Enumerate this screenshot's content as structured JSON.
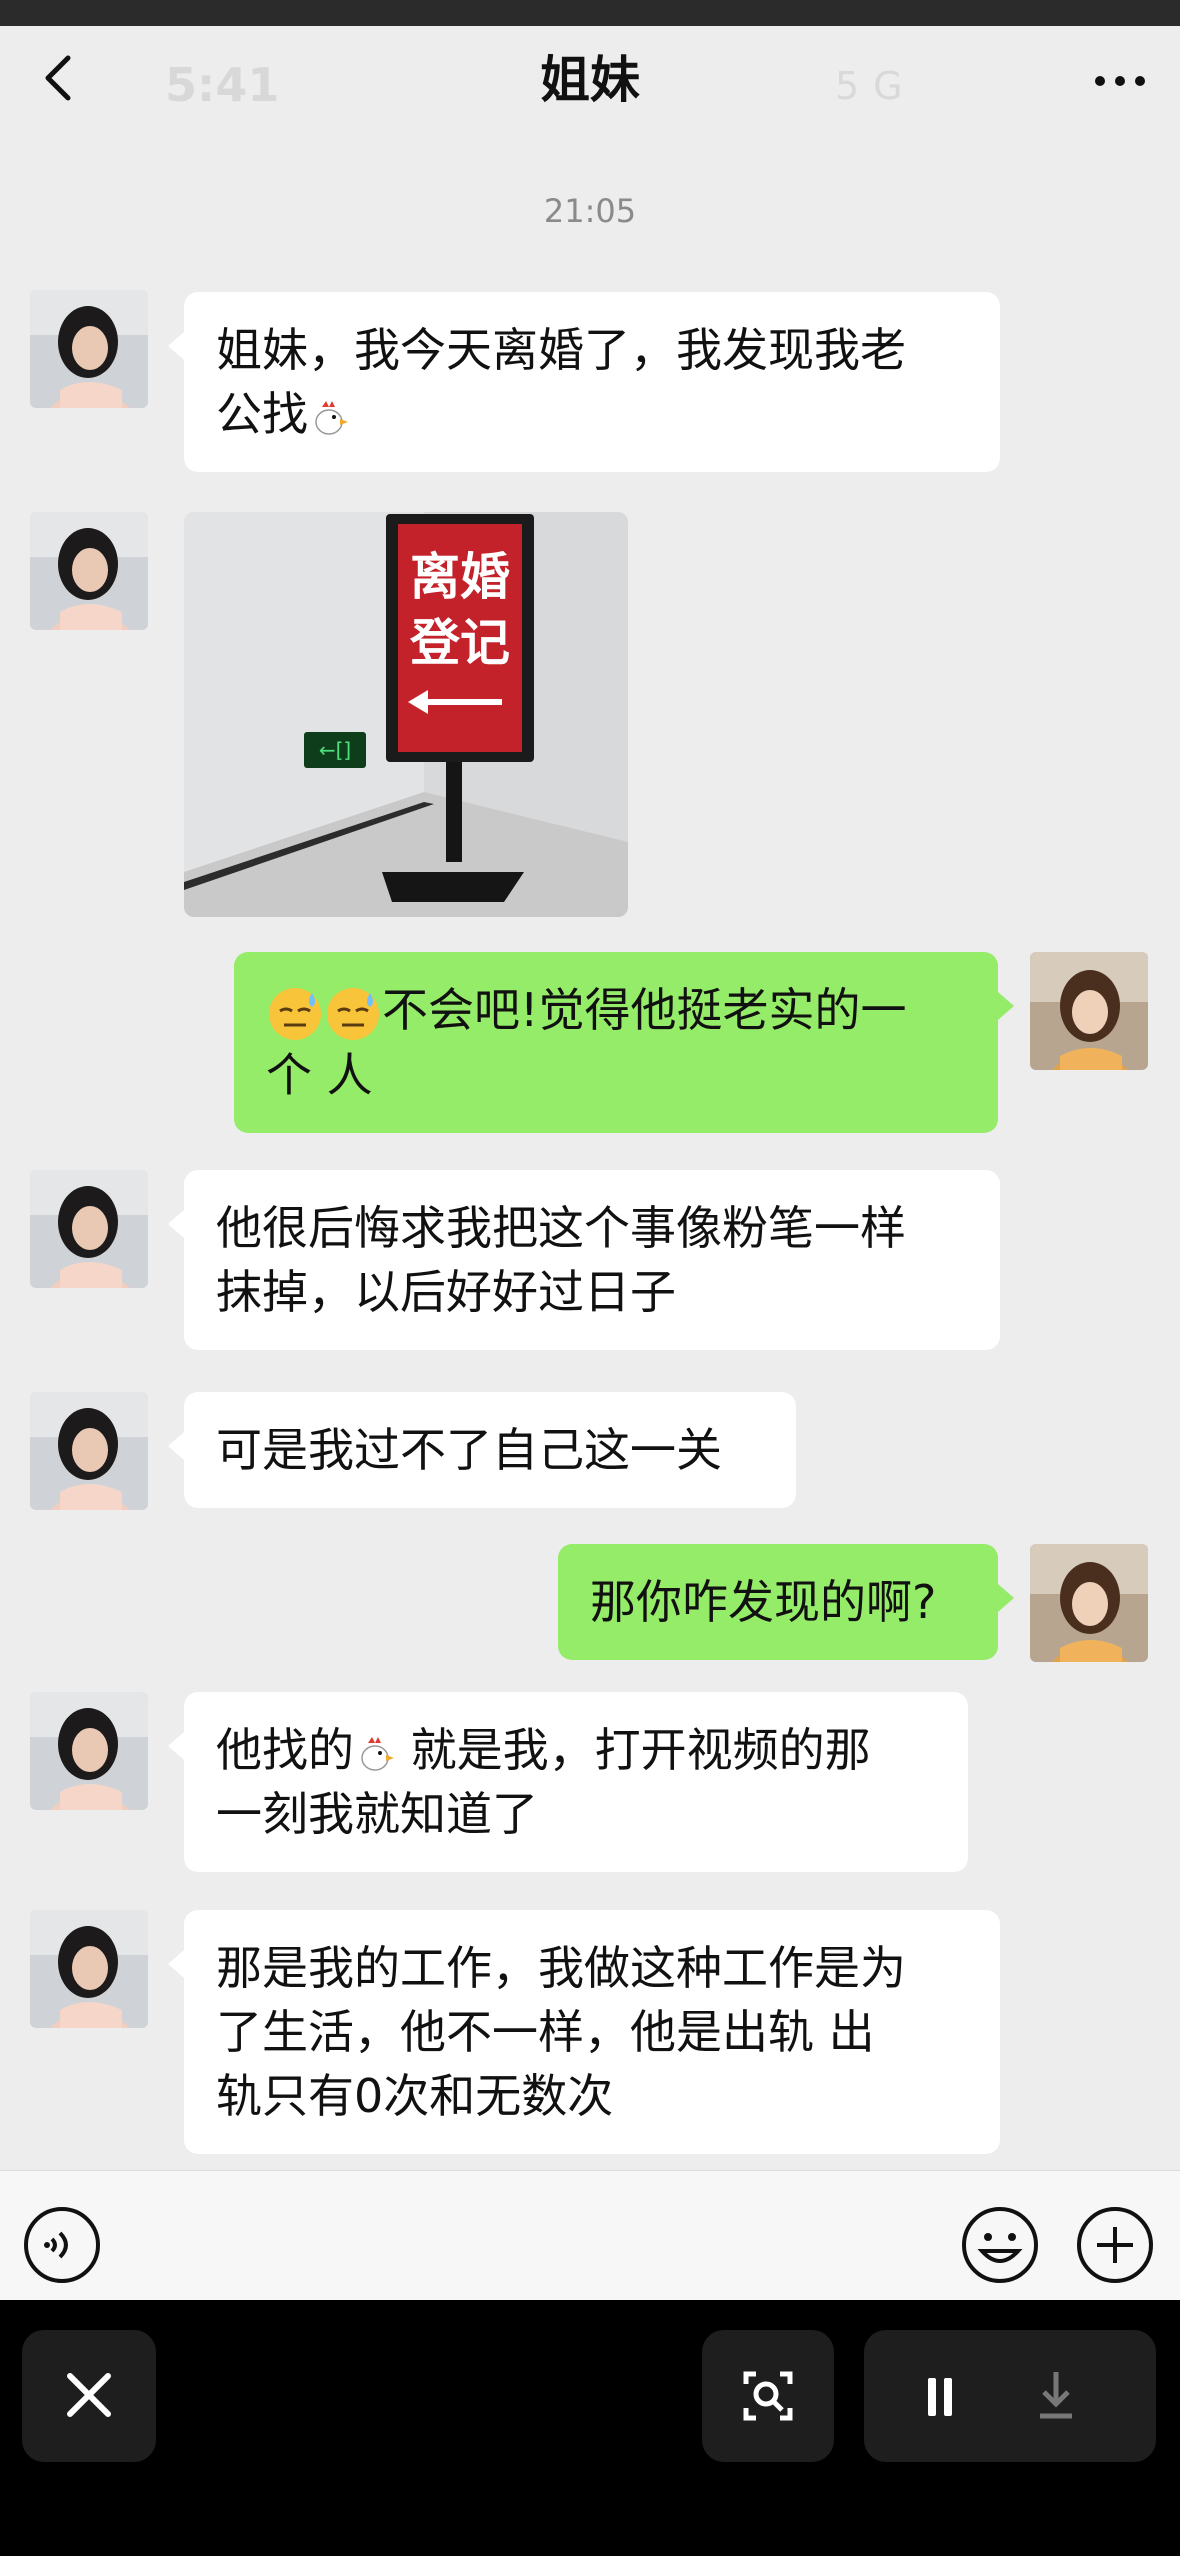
{
  "status_bar": {
    "time": "5:41",
    "signal": "5G"
  },
  "header": {
    "title": "姐妹"
  },
  "chat": {
    "timestamp": "21:05",
    "messages": [
      {
        "line1": "姐妹，我今天离婚了，我发现我老",
        "line2": "公找"
      },
      {
        "sign_line1": "离婚",
        "sign_line2": "登记",
        "exit_label": "←[]"
      },
      {
        "line1": "不会吧!觉得他挺老实的一",
        "line2": "个 人"
      },
      {
        "line1": "他很后悔求我把这个事像粉笔一样",
        "line2": "抹掉，以后好好过日子"
      },
      {
        "line1": "可是我过不了自己这一关"
      },
      {
        "line1": "那你咋发现的啊?"
      },
      {
        "line1a": "他找的",
        "line1b": " 就是我，打开视频的那",
        "line2": "一刻我就知道了"
      },
      {
        "line1": "那是我的工作，我做这种工作是为",
        "line2": "了生活，他不一样，他是出轨 出",
        "line3": "轨只有0次和无数次"
      }
    ]
  },
  "icons": {
    "back": "chevron-left-icon",
    "more": "more-dots-icon",
    "voice": "voice-icon",
    "emoji": "emoji-icon",
    "plus": "plus-icon",
    "close": "close-icon",
    "scan": "scan-icon",
    "pause": "pause-icon",
    "download": "download-icon"
  },
  "colors": {
    "bubble_out": "#95ec69",
    "bubble_in": "#ffffff",
    "background": "#ededed"
  }
}
